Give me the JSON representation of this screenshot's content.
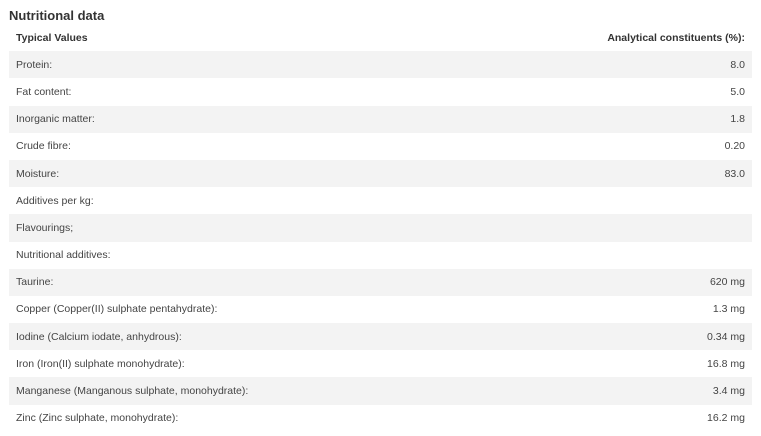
{
  "title": "Nutritional data",
  "table": {
    "headers": [
      "Typical Values",
      "Analytical constituents (%):"
    ],
    "rows": [
      [
        "Protein:",
        "8.0"
      ],
      [
        "Fat content:",
        "5.0"
      ],
      [
        "Inorganic matter:",
        "1.8"
      ],
      [
        "Crude fibre:",
        "0.20"
      ],
      [
        "Moisture:",
        "83.0"
      ],
      [
        "Additives per kg:",
        ""
      ],
      [
        "Flavourings;",
        ""
      ],
      [
        "Nutritional additives:",
        ""
      ],
      [
        "Taurine:",
        "620 mg"
      ],
      [
        "Copper (Copper(II) sulphate pentahydrate):",
        "1.3 mg"
      ],
      [
        "Iodine (Calcium iodate, anhydrous):",
        "0.34 mg"
      ],
      [
        "Iron (Iron(II) sulphate monohydrate):",
        "16.8 mg"
      ],
      [
        "Manganese (Manganous sulphate, monohydrate):",
        "3.4 mg"
      ],
      [
        "Zinc (Zinc sulphate, monohydrate):",
        "16.2 mg"
      ]
    ]
  }
}
